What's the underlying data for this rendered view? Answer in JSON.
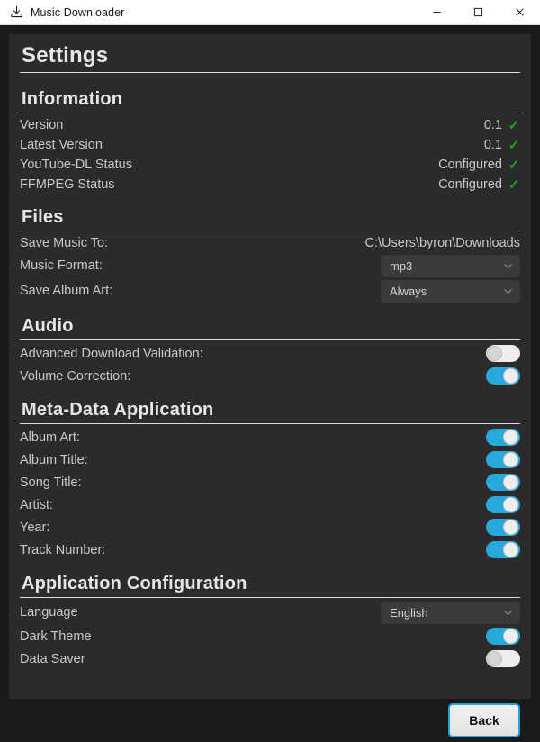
{
  "window": {
    "title": "Music Downloader",
    "icon": "download-icon",
    "controls": {
      "minimize": "—",
      "maximize": "□",
      "close": "✕"
    }
  },
  "page": {
    "title": "Settings"
  },
  "colors": {
    "accent": "#29a8db",
    "focus_border": "#21a3e0",
    "check_green": "#20a020",
    "panel_bg": "#2b2b2b",
    "window_bg": "#1a1a1a",
    "dropdown_bg": "#3b3b3b",
    "text": "#c9c9c9",
    "heading_text": "#e6e6e6"
  },
  "sections": [
    {
      "id": "information",
      "header": "Information",
      "rows": [
        {
          "label": "Version",
          "value": "0.1",
          "check": "✓",
          "control": "text-check"
        },
        {
          "label": "Latest Version",
          "value": "0.1",
          "check": "✓",
          "control": "text-check"
        },
        {
          "label": "YouTube-DL Status",
          "value": "Configured",
          "check": "✓",
          "control": "text-check"
        },
        {
          "label": "FFMPEG Status",
          "value": "Configured",
          "check": "✓",
          "control": "text-check"
        }
      ]
    },
    {
      "id": "files",
      "header": "Files",
      "rows": [
        {
          "label": "Save Music To:",
          "value": "C:\\Users\\byron\\Downloads",
          "control": "text"
        },
        {
          "label": "Music Format:",
          "value": "mp3",
          "control": "dropdown"
        },
        {
          "label": "Save Album Art:",
          "value": "Always",
          "control": "dropdown"
        }
      ]
    },
    {
      "id": "audio",
      "header": "Audio",
      "rows": [
        {
          "label": "Advanced Download Validation:",
          "control": "toggle",
          "state": "off"
        },
        {
          "label": "Volume Correction:",
          "control": "toggle",
          "state": "on"
        }
      ]
    },
    {
      "id": "meta-data-application",
      "header": "Meta-Data Application",
      "rows": [
        {
          "label": "Album Art:",
          "control": "toggle",
          "state": "on"
        },
        {
          "label": "Album Title:",
          "control": "toggle",
          "state": "on"
        },
        {
          "label": "Song Title:",
          "control": "toggle",
          "state": "on"
        },
        {
          "label": "Artist:",
          "control": "toggle",
          "state": "on"
        },
        {
          "label": "Year:",
          "control": "toggle",
          "state": "on"
        },
        {
          "label": "Track Number:",
          "control": "toggle",
          "state": "on"
        }
      ]
    },
    {
      "id": "application-configuration",
      "header": "Application Configuration",
      "rows": [
        {
          "label": "Language",
          "value": "English",
          "control": "dropdown"
        },
        {
          "label": "Dark Theme",
          "control": "toggle",
          "state": "on"
        },
        {
          "label": "Data Saver",
          "control": "toggle",
          "state": "off"
        }
      ]
    }
  ],
  "footer": {
    "back_label": "Back"
  }
}
